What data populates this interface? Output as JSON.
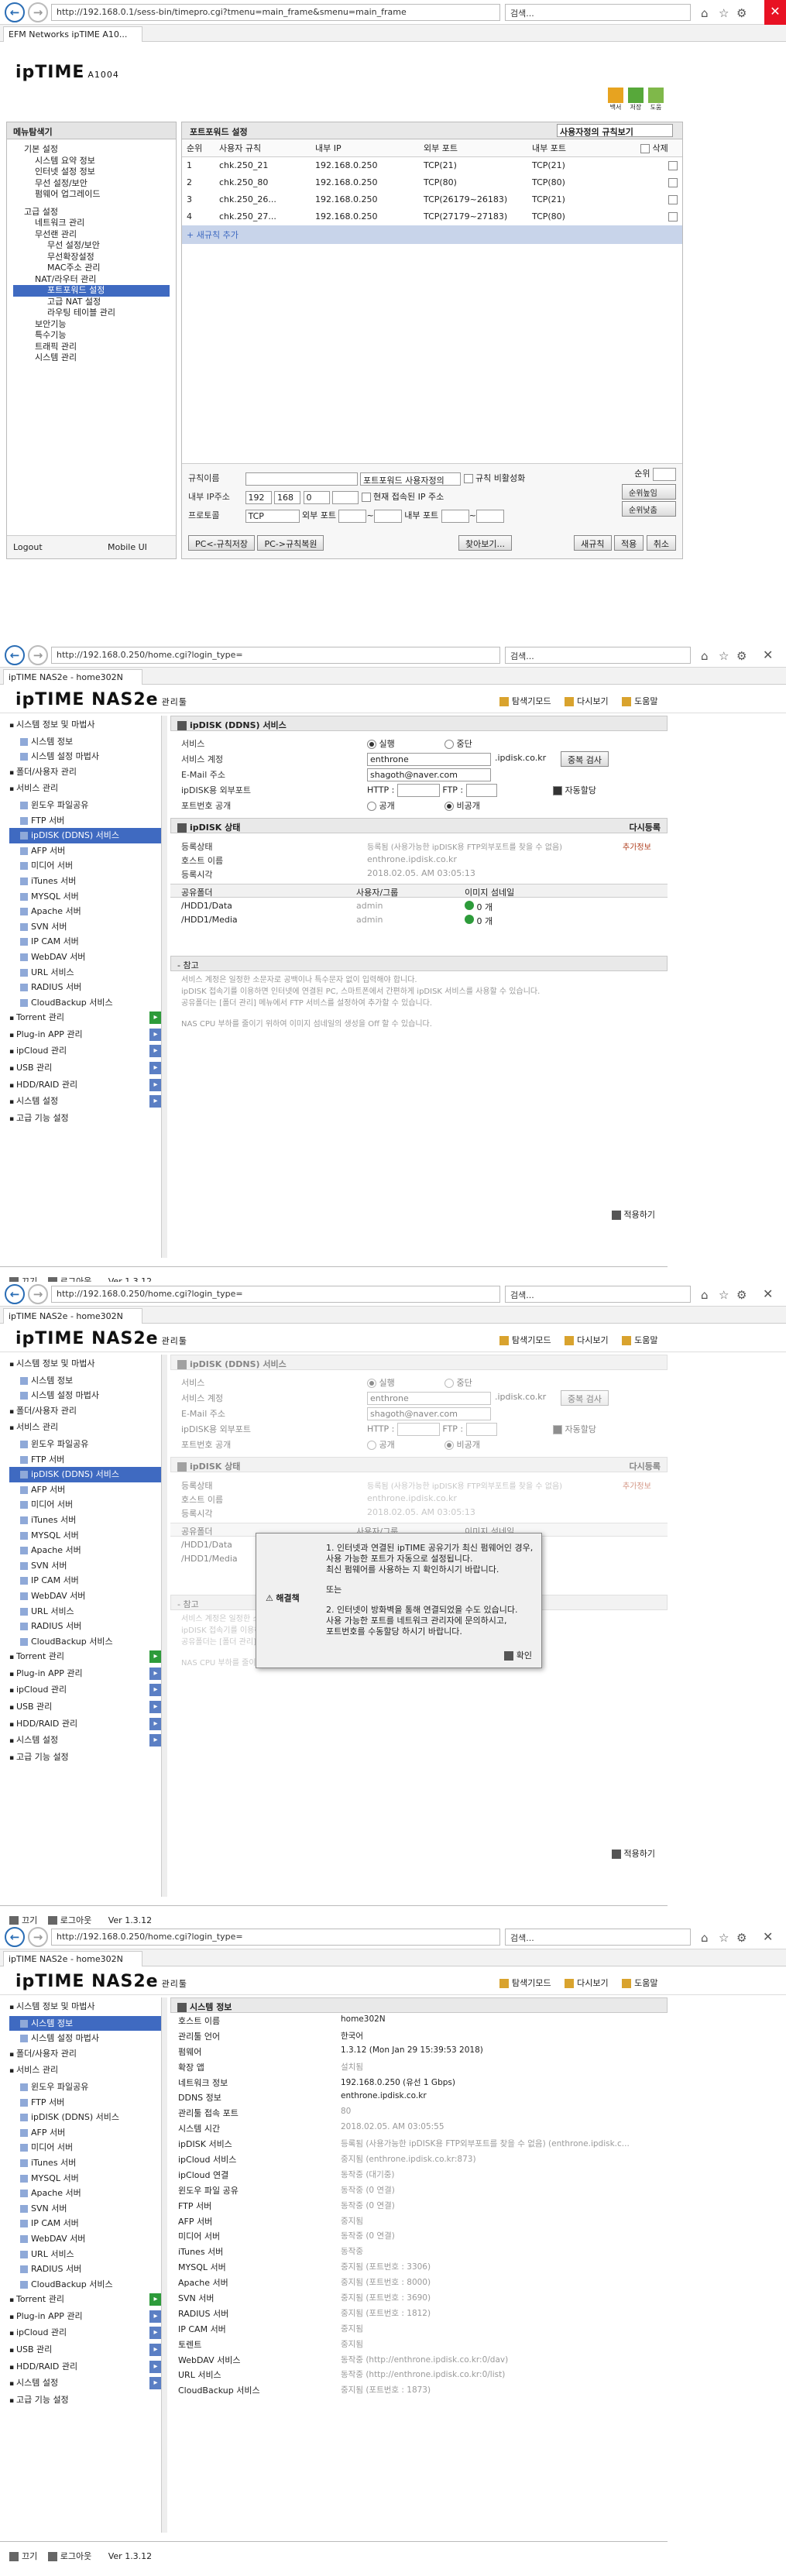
{
  "p1": {
    "url": "http://192.168.0.1/sess-bin/timepro.cgi?tmenu=main_frame&smenu=main_frame",
    "search_placeholder": "검색...",
    "tab_title": "EFM Networks ipTIME A10...",
    "logo": "ipTIME",
    "model": "A1004",
    "top_icons": [
      "백서",
      "저장",
      "도움"
    ],
    "sidebar_title": "메뉴탐색기",
    "tree": [
      {
        "t": "기본 설정",
        "l": 1
      },
      {
        "t": "시스템 요약 정보",
        "l": 2
      },
      {
        "t": "인터넷 설정 정보",
        "l": 2
      },
      {
        "t": "무선 설정/보안",
        "l": 2
      },
      {
        "t": "펌웨어 업그레이드",
        "l": 2
      },
      {
        "t": "고급 설정",
        "l": 1
      },
      {
        "t": "네트워크 관리",
        "l": 2
      },
      {
        "t": "무선랜 관리",
        "l": 2
      },
      {
        "t": "무선 설정/보안",
        "l": 3
      },
      {
        "t": "무선확장설정",
        "l": 3
      },
      {
        "t": "MAC주소 관리",
        "l": 3
      },
      {
        "t": "NAT/라우터 관리",
        "l": 2
      },
      {
        "t": "포트포워드 설정",
        "l": 3,
        "sel": true
      },
      {
        "t": "고급 NAT 설정",
        "l": 3
      },
      {
        "t": "라우팅 테이블 관리",
        "l": 3
      },
      {
        "t": "보안기능",
        "l": 2
      },
      {
        "t": "특수기능",
        "l": 2
      },
      {
        "t": "트래픽 관리",
        "l": 2
      },
      {
        "t": "시스템 관리",
        "l": 2
      }
    ],
    "logout": "Logout",
    "mobile": "Mobile UI",
    "content_title": "포트포워드 설정",
    "rule_select": "사용자정의 규칙보기",
    "cols": [
      "순위",
      "사용자 규칙",
      "내부 IP",
      "외부 포트",
      "내부 포트",
      "삭제"
    ],
    "rows": [
      {
        "n": "1",
        "name": "chk.250_21",
        "ip": "192.168.0.250",
        "ext": "TCP(21)",
        "int": "TCP(21)"
      },
      {
        "n": "2",
        "name": "chk.250_80",
        "ip": "192.168.0.250",
        "ext": "TCP(80)",
        "int": "TCP(80)"
      },
      {
        "n": "3",
        "name": "chk.250_26...",
        "ip": "192.168.0.250",
        "ext": "TCP(26179~26183)",
        "int": "TCP(21)"
      },
      {
        "n": "4",
        "name": "chk.250_27...",
        "ip": "192.168.0.250",
        "ext": "TCP(27179~27183)",
        "int": "TCP(80)"
      }
    ],
    "add_new": "새규칙 추가",
    "form": {
      "rule_name": "규칙이름",
      "rule_type": "포트포워드 사용자정의",
      "disable_rule": "규칙 비활성화",
      "rank": "순위",
      "internal_ip": "내부 IP주소",
      "ip1": "192",
      "ip2": "168",
      "ip3": "0",
      "current_ip": "현재 접속된 IP 주소",
      "protocol": "프로토콜",
      "proto_val": "TCP",
      "ext_port": "외부 포트",
      "int_port": "내부 포트",
      "tilde": "~",
      "btn_up": "순위높임",
      "btn_down": "순위낮춤",
      "btn_save_pc": "PC<-규칙저장",
      "btn_restore_pc": "PC->규칙복원",
      "btn_find": "찾아보기...",
      "btn_new": "새규칙",
      "btn_apply": "적용",
      "btn_cancel": "취소"
    }
  },
  "nas": {
    "url": "http://192.168.0.250/home.cgi?login_type=",
    "search_placeholder": "검색...",
    "tab_title": "ipTIME NAS2e - home302N",
    "logo": "ipTIME",
    "model": "NAS2e",
    "model_suffix": "관리툴",
    "links": [
      "탐색기모드",
      "다시보기",
      "도움말"
    ],
    "sidebar": [
      {
        "t": "시스템 정보 및 마법사",
        "l": 0
      },
      {
        "t": "시스템 정보",
        "l": 1
      },
      {
        "t": "시스템 설정 마법사",
        "l": 1
      },
      {
        "t": "폴더/사용자 관리",
        "l": 0
      },
      {
        "t": "서비스 관리",
        "l": 0
      },
      {
        "t": "윈도우 파일공유",
        "l": 1
      },
      {
        "t": "FTP 서버",
        "l": 1
      },
      {
        "t": "ipDISK (DDNS) 서비스",
        "l": 1
      },
      {
        "t": "AFP 서버",
        "l": 1
      },
      {
        "t": "미디어 서버",
        "l": 1
      },
      {
        "t": "iTunes 서버",
        "l": 1
      },
      {
        "t": "MYSQL 서버",
        "l": 1
      },
      {
        "t": "Apache 서버",
        "l": 1
      },
      {
        "t": "SVN 서버",
        "l": 1
      },
      {
        "t": "IP CAM 서버",
        "l": 1
      },
      {
        "t": "WebDAV 서버",
        "l": 1
      },
      {
        "t": "URL 서비스",
        "l": 1
      },
      {
        "t": "RADIUS 서버",
        "l": 1
      },
      {
        "t": "CloudBackup 서비스",
        "l": 1
      },
      {
        "t": "Torrent 관리",
        "l": 0
      },
      {
        "t": "Plug-in APP 관리",
        "l": 0
      },
      {
        "t": "ipCloud 관리",
        "l": 0
      },
      {
        "t": "USB 관리",
        "l": 0
      },
      {
        "t": "HDD/RAID 관리",
        "l": 0
      },
      {
        "t": "시스템 설정",
        "l": 0
      },
      {
        "t": "고급 기능 설정",
        "l": 0
      }
    ],
    "close": "끄기",
    "logout": "로그아웃",
    "version": "Ver 1.3.12"
  },
  "p2": {
    "section": "ipDISK (DDNS) 서비스",
    "service": "서비스",
    "run": "실행",
    "stop": "중단",
    "account": "서비스 계정",
    "account_val": "enthrone",
    "domain": ".ipdisk.co.kr",
    "dup_check": "중복 검사",
    "email": "E-Mail 주소",
    "email_val": "shagoth@naver.com",
    "ext_port": "ipDISK용 외부포트",
    "http": "HTTP :",
    "ftp": "FTP :",
    "auto": "자동할당",
    "public": "포트번호 공개",
    "pub": "공개",
    "priv": "비공개",
    "status": "ipDISK 상태",
    "re_register": "다시등록",
    "reg_status": "등록상태",
    "reg_status_val": "등록됨 (사용가능한 ipDISK용 FTP외부포트를 찾을 수 없음)",
    "add_info": "추가정보",
    "host": "호스트 이름",
    "host_val": "enthrone.ipdisk.co.kr",
    "reg_time": "등록시각",
    "reg_time_val": "2018.02.05. AM 03:05:13",
    "share": "공유폴더",
    "user_group": "사용자/그룹",
    "thumb": "이미지 섬네일",
    "folders": [
      {
        "f": "/HDD1/Data",
        "u": "admin",
        "c": "0 개"
      },
      {
        "f": "/HDD1/Media",
        "u": "admin",
        "c": "0 개"
      }
    ],
    "note_title": "참고",
    "notes": [
      "서비스 계정은 일정한 소문자로 공백이나 특수문자 없이 입력해야 합니다.",
      "ipDISK 접속기를 이용하면 인터넷에 연결된 PC, 스마트폰에서 간편하게 ipDISK 서비스를 사용할 수 있습니다.",
      "공유폴더는 [폴더 관리] 메뉴에서 FTP 서비스를 설정하여 추가할 수 있습니다.",
      "NAS CPU 부하를 줄이기 위하여 이미지 섬네일의 생성을 Off 할 수 있습니다."
    ],
    "apply": "적용하기"
  },
  "p3": {
    "dlg_title": "해결책",
    "dlg_lines": [
      "1. 인터넷과 연결된 ipTIME 공유기가 최신 펌웨어인 경우,",
      "사용 가능한 포트가 자동으로 설정됩니다.",
      "최신 펌웨어를 사용하는 지 확인하시기 바랍니다.",
      "또는",
      "2. 인터넷이 방화벽을 통해 연결되었을 수도 있습니다.",
      "사용 가능한 포트를 네트워크 관리자에 문의하시고,",
      "포트번호를 수동할당 하시기 바랍니다."
    ],
    "ok": "확인"
  },
  "p4": {
    "section": "시스템 정보",
    "rows": [
      [
        "호스트 이름",
        "home302N"
      ],
      [
        "관리툴 언어",
        "한국어"
      ],
      [
        "펌웨어",
        "1.3.12 (Mon Jan 29 15:39:53 2018)"
      ],
      [
        "확장 앱",
        "설치됨"
      ],
      [
        "네트워크 정보",
        "192.168.0.250 (유선 1 Gbps)"
      ],
      [
        "DDNS 정보",
        "enthrone.ipdisk.co.kr"
      ],
      [
        "관리툴 접속 포트",
        "80"
      ],
      [
        "시스템 시간",
        "2018.02.05. AM 03:05:55"
      ],
      [
        "ipDISK 서비스",
        "등록됨 (사용가능한 ipDISK용 FTP외부포트를 찾을 수 없음) (enthrone.ipdisk.c..."
      ],
      [
        "ipCloud 서비스",
        "중지됨 (enthrone.ipdisk.co.kr:873)"
      ],
      [
        "ipCloud 연결",
        "동작중 (대기중)"
      ],
      [
        "윈도우 파일 공유",
        "동작중 (0 연결)"
      ],
      [
        "FTP 서버",
        "동작중 (0 연결)"
      ],
      [
        "AFP 서버",
        "중지됨"
      ],
      [
        "미디어 서버",
        "동작중 (0 연결)"
      ],
      [
        "iTunes 서버",
        "동작중"
      ],
      [
        "MYSQL 서버",
        "중지됨 (포트번호 : 3306)"
      ],
      [
        "Apache 서버",
        "중지됨 (포트번호 : 8000)"
      ],
      [
        "SVN 서버",
        "중지됨 (포트번호 : 3690)"
      ],
      [
        "RADIUS 서버",
        "중지됨 (포트번호 : 1812)"
      ],
      [
        "IP CAM 서버",
        "중지됨"
      ],
      [
        "토렌트",
        "중지됨"
      ],
      [
        "WebDAV 서비스",
        "동작중 (http://enthrone.ipdisk.co.kr:0/dav)"
      ],
      [
        "URL 서비스",
        "동작중 (http://enthrone.ipdisk.co.kr:0/list)"
      ],
      [
        "CloudBackup 서비스",
        "중지됨 (포트번호 : 1873)"
      ]
    ]
  },
  "colors": {
    "accent": "#3f6ac1",
    "browser_blue": "#2a6db5",
    "close_red": "#e81123",
    "dialog_bg": "#f0f0f0"
  }
}
